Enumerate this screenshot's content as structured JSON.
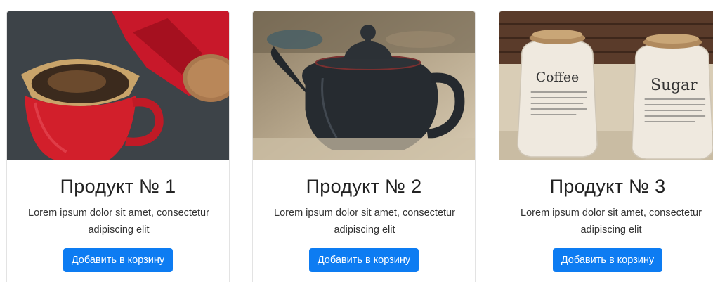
{
  "products": [
    {
      "title": "Продукт № 1",
      "text": "Lorem ipsum dolor sit amet, consectetur adipiscing elit",
      "button": "Добавить в корзину",
      "image": "coffee-cup-photo"
    },
    {
      "title": "Продукт № 2",
      "text": "Lorem ipsum dolor sit amet, consectetur adipiscing elit",
      "button": "Добавить в корзину",
      "image": "teapot-photo"
    },
    {
      "title": "Продукт № 3",
      "text": "Lorem ipsum dolor sit amet, consectetur adipiscing elit",
      "button": "Добавить в корзину",
      "image": "coffee-sugar-jars-photo",
      "image_labels": [
        "Coffee",
        "Sugar"
      ]
    }
  ],
  "colors": {
    "button": "#0d7cf2",
    "card_border": "#e3e3e3"
  }
}
